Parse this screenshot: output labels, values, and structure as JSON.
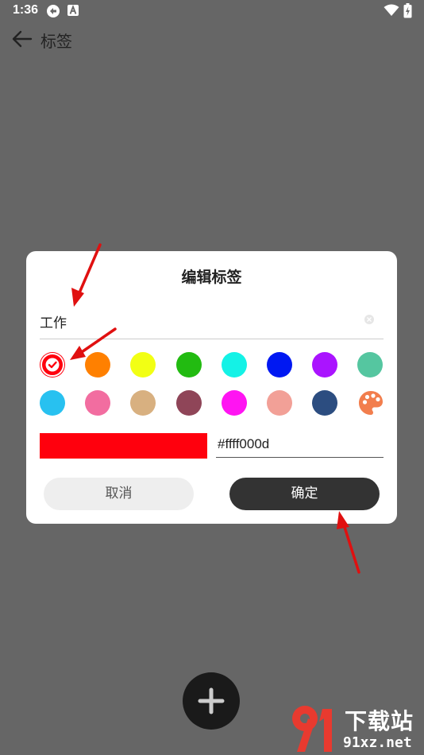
{
  "status_bar": {
    "time": "1:36",
    "icons": [
      "sync-icon",
      "text-a-icon",
      "wifi-icon",
      "battery-icon"
    ]
  },
  "app_bar": {
    "title": "标签",
    "back_icon": "arrow-left-icon"
  },
  "dialog": {
    "title": "编辑标签",
    "name_value": "工作",
    "clear_icon": "close-icon",
    "colors": [
      {
        "hex": "#ff000d",
        "selected": true
      },
      {
        "hex": "#ff8000",
        "selected": false
      },
      {
        "hex": "#f2ff14",
        "selected": false
      },
      {
        "hex": "#22bb11",
        "selected": false
      },
      {
        "hex": "#14f2e6",
        "selected": false
      },
      {
        "hex": "#0018f2",
        "selected": false
      },
      {
        "hex": "#aa14ff",
        "selected": false
      },
      {
        "hex": "#55c6a0",
        "selected": false
      },
      {
        "hex": "#28c1f0",
        "selected": false
      },
      {
        "hex": "#f26da0",
        "selected": false
      },
      {
        "hex": "#d8b080",
        "selected": false
      },
      {
        "hex": "#8f4558",
        "selected": false
      },
      {
        "hex": "#ff14f2",
        "selected": false
      },
      {
        "hex": "#f2a097",
        "selected": false
      },
      {
        "hex": "#2c4d80",
        "selected": false
      }
    ],
    "palette_icon": "palette-icon",
    "palette_color": "#f27e4d",
    "preview_color": "#ff000d",
    "hex_value": "#ffff000d",
    "cancel_label": "取消",
    "confirm_label": "确定"
  },
  "fab": {
    "icon": "plus-icon"
  },
  "watermark": {
    "big_text": "下载站",
    "small_text": "91xz.net"
  },
  "colors": {
    "overlay": "#666666",
    "dialog_bg": "#ffffff",
    "confirm_bg": "#333333",
    "cancel_bg": "#eeeeee",
    "annotation_arrow": "#e01010"
  }
}
